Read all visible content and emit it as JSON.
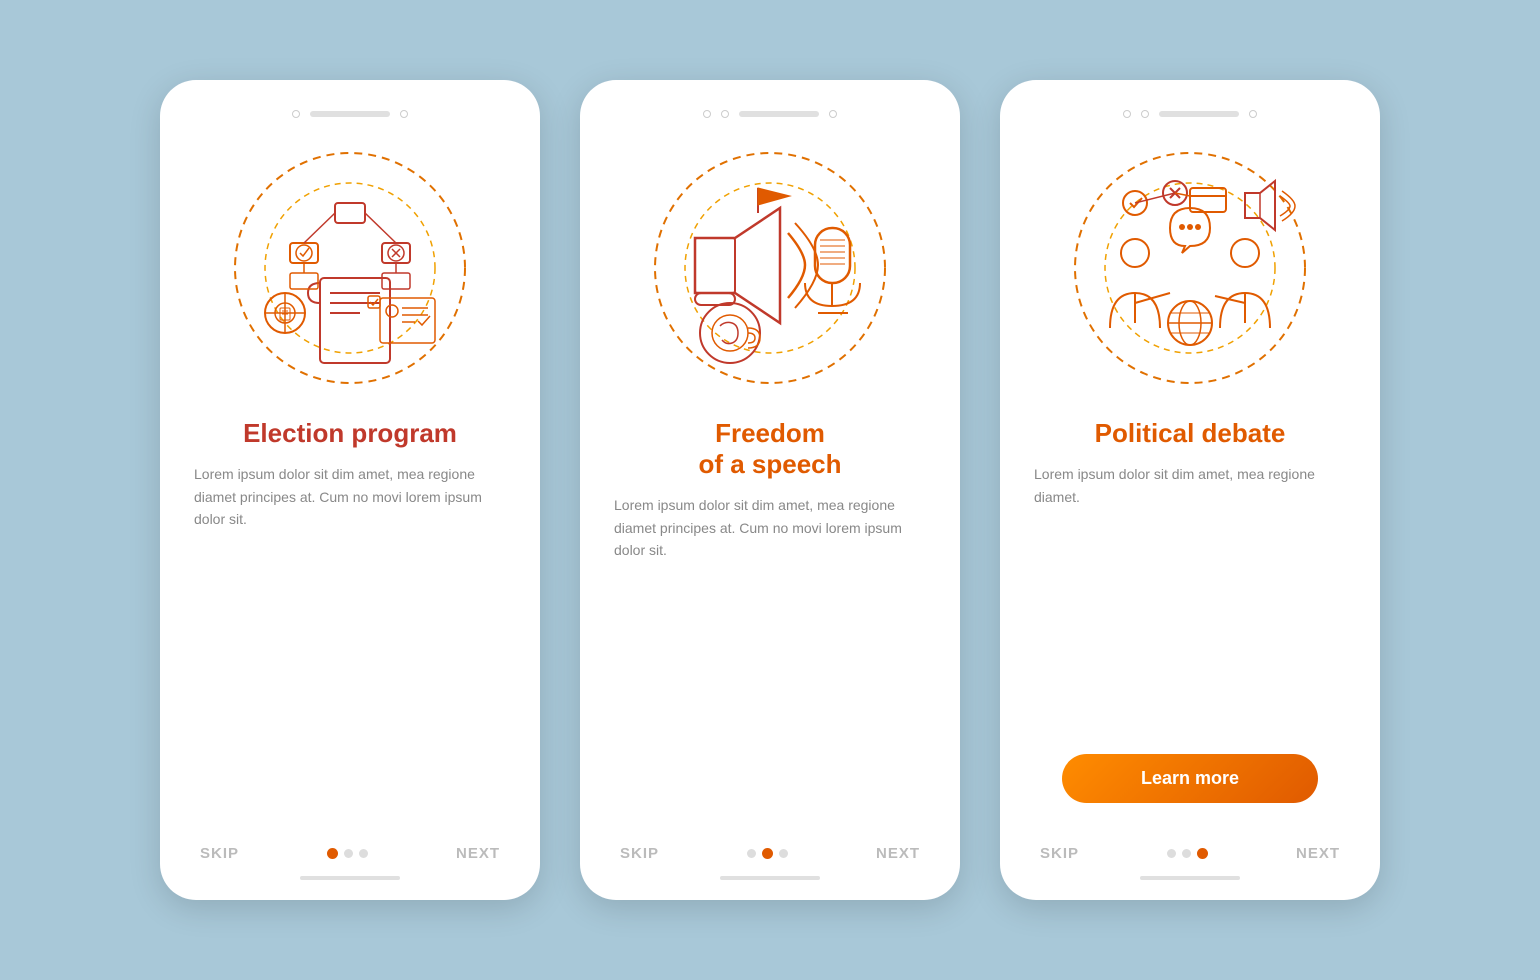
{
  "screens": [
    {
      "id": "screen1",
      "indicator_dots": [
        {
          "filled": true
        },
        {
          "filled": false
        },
        {
          "filled": false
        }
      ],
      "title": "Election program",
      "description": "Lorem ipsum dolor sit dim amet, mea regione diamet principes at. Cum no movi lorem ipsum dolor sit.",
      "skip_label": "SKIP",
      "next_label": "NEXT",
      "nav_dots": [
        {
          "active": true
        },
        {
          "active": false
        },
        {
          "active": false
        }
      ],
      "show_learn_more": false,
      "learn_more_label": ""
    },
    {
      "id": "screen2",
      "indicator_dots": [
        {
          "filled": false
        },
        {
          "filled": false
        },
        {
          "filled": false
        }
      ],
      "title": "Freedom\nof a speech",
      "description": "Lorem ipsum dolor sit dim amet, mea regione diamet principes at. Cum no movi lorem ipsum dolor sit.",
      "skip_label": "SKIP",
      "next_label": "NEXT",
      "nav_dots": [
        {
          "active": false
        },
        {
          "active": true
        },
        {
          "active": false
        }
      ],
      "show_learn_more": false,
      "learn_more_label": ""
    },
    {
      "id": "screen3",
      "indicator_dots": [
        {
          "filled": false
        },
        {
          "filled": false
        },
        {
          "filled": false
        }
      ],
      "title": "Political debate",
      "description": "Lorem ipsum dolor sit dim amet, mea regione diamet.",
      "skip_label": "SKIP",
      "next_label": "NEXT",
      "nav_dots": [
        {
          "active": false
        },
        {
          "active": false
        },
        {
          "active": true
        }
      ],
      "show_learn_more": true,
      "learn_more_label": "Learn more"
    }
  ],
  "colors": {
    "orange_primary": "#e05a00",
    "red_primary": "#c0392b",
    "orange_gradient_start": "#ff8c00",
    "dashed_orange": "#e07000",
    "dashed_yellow": "#f0a000"
  }
}
